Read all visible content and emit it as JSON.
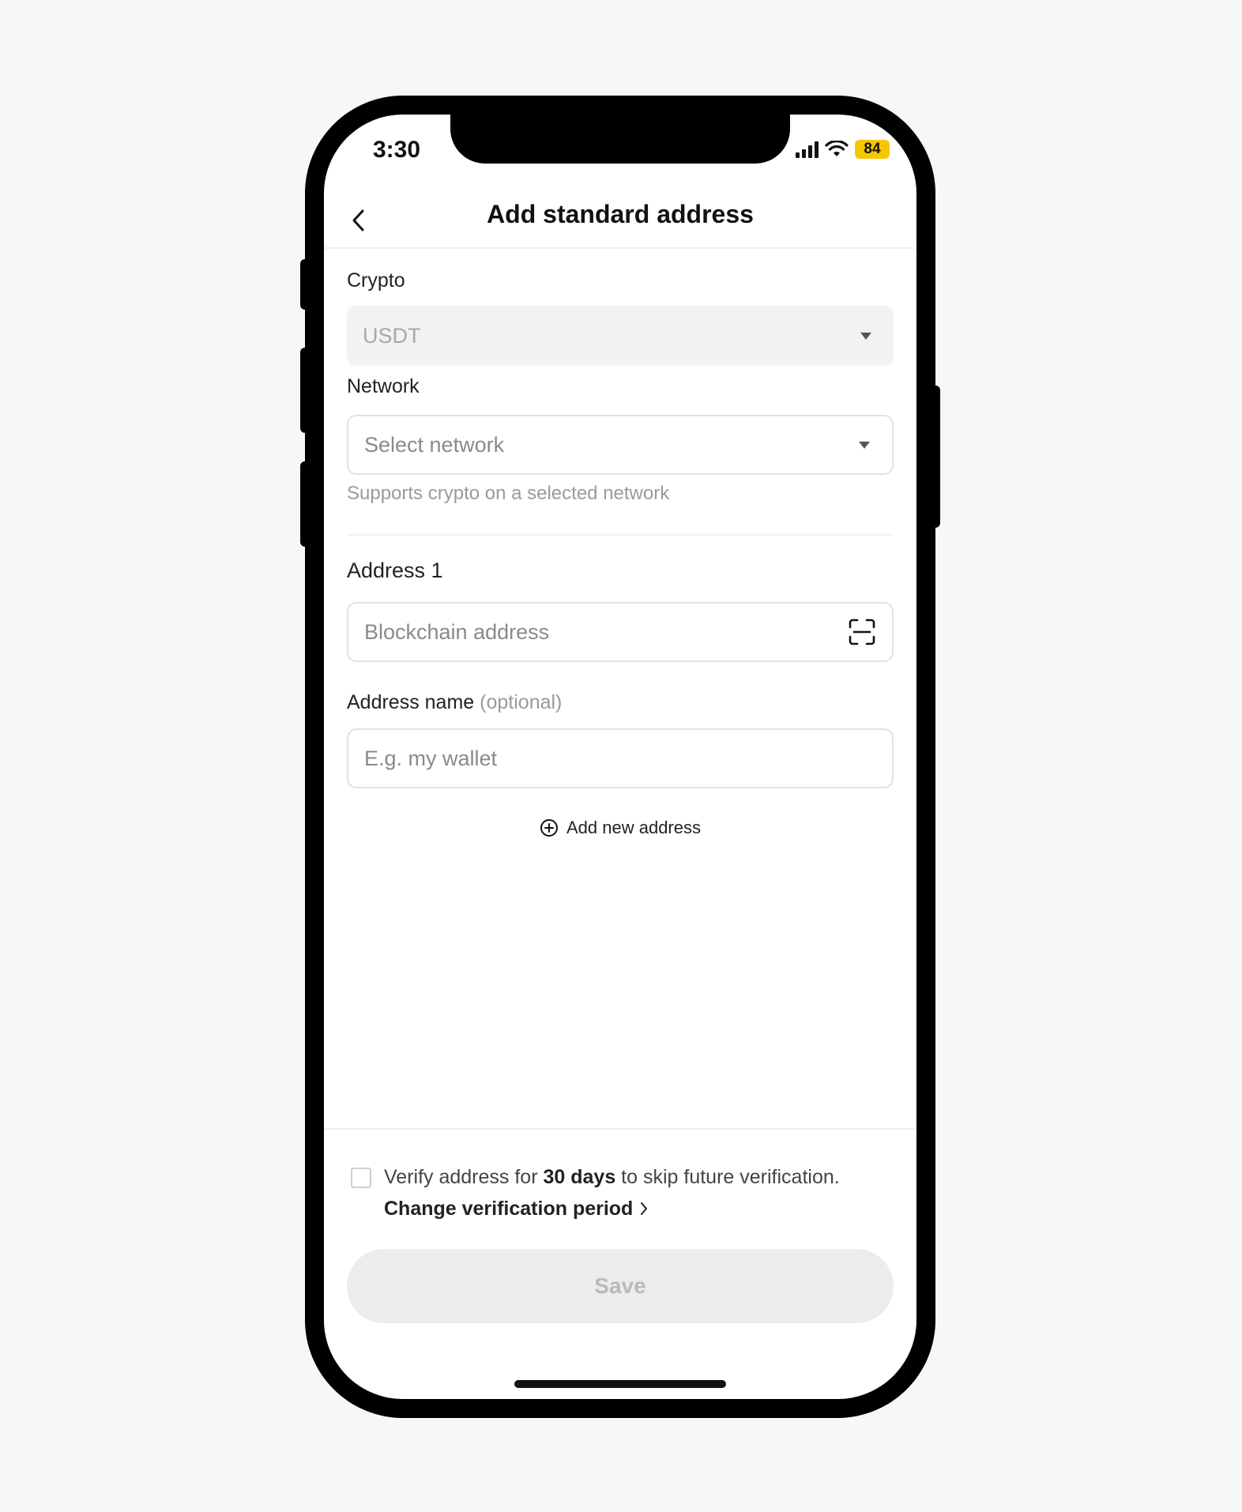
{
  "status_bar": {
    "time": "3:30",
    "battery": "84"
  },
  "header": {
    "title": "Add standard address"
  },
  "form": {
    "crypto": {
      "label": "Crypto",
      "value": "USDT"
    },
    "network": {
      "label": "Network",
      "placeholder": "Select network",
      "helper": "Supports crypto on a selected network"
    },
    "address": {
      "label": "Address 1",
      "placeholder": "Blockchain address"
    },
    "address_name": {
      "label": "Address name",
      "optional": "(optional)",
      "placeholder": "E.g. my wallet"
    },
    "add_new": "Add new address"
  },
  "verify": {
    "prefix": "Verify address for ",
    "days": "30 days",
    "suffix": " to skip future verification.",
    "change_link": "Change verification period"
  },
  "save_label": "Save",
  "colors": {
    "battery": "#f6c600",
    "disabled_bg": "#ececec"
  }
}
